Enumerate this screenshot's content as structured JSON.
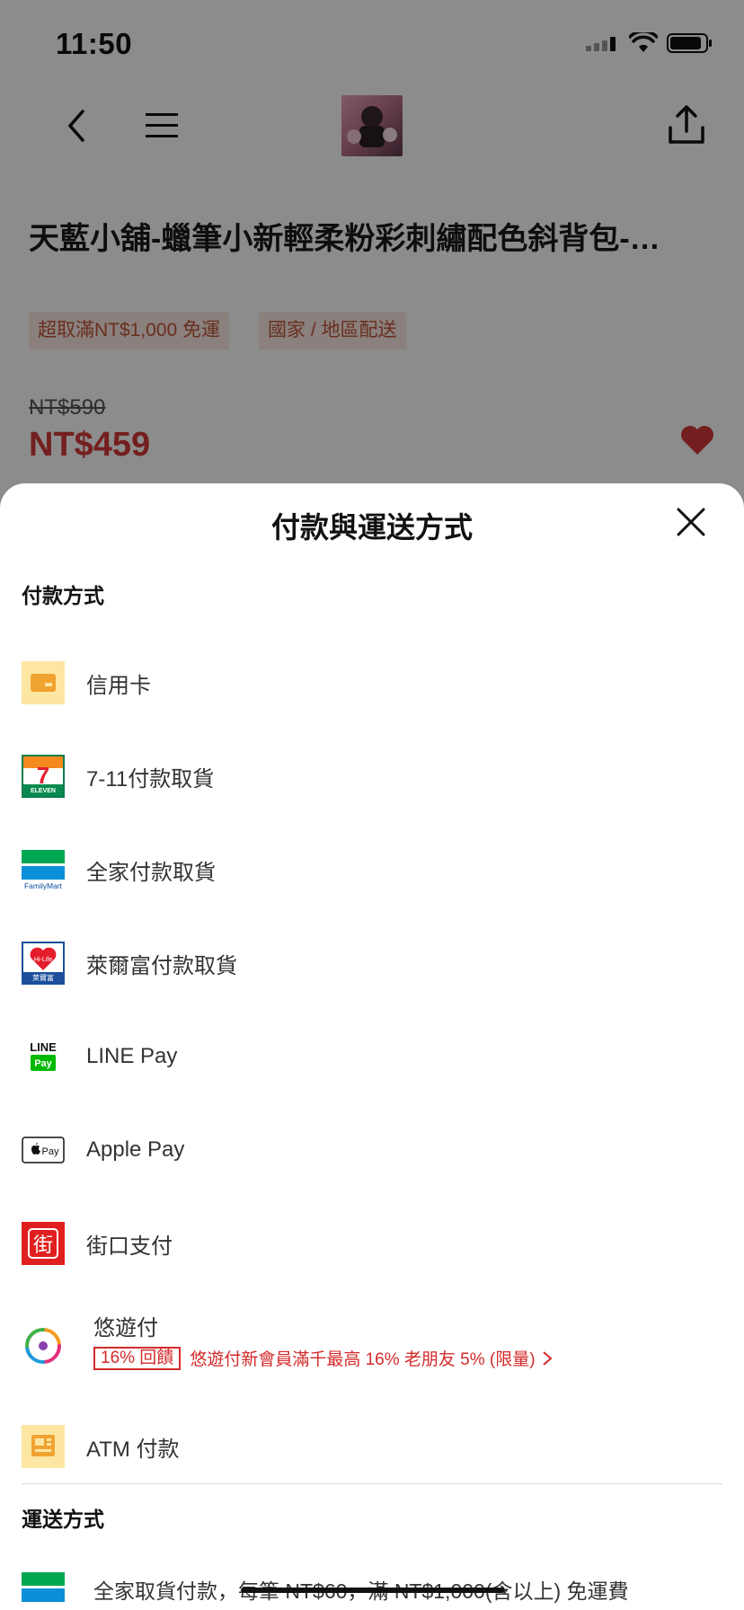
{
  "status": {
    "time": "11:50"
  },
  "product": {
    "title": "天藍小舖-蠟筆小新輕柔粉彩刺繡配色斜背包-…",
    "tags": [
      "超取滿NT$1,000 免運",
      "國家 / 地區配送"
    ],
    "original_price": "NT$590",
    "price": "NT$459"
  },
  "sheet": {
    "title": "付款與運送方式",
    "payment_section": "付款方式",
    "payment_methods": [
      {
        "label": "信用卡",
        "icon": "credit-card-icon"
      },
      {
        "label": "7-11付款取貨",
        "icon": "seven-eleven-icon"
      },
      {
        "label": "全家付款取貨",
        "icon": "familymart-icon"
      },
      {
        "label": "萊爾富付款取貨",
        "icon": "hilife-icon"
      },
      {
        "label": "LINE Pay",
        "icon": "line-pay-icon"
      },
      {
        "label": "Apple Pay",
        "icon": "apple-pay-icon"
      },
      {
        "label": "街口支付",
        "icon": "jkopay-icon"
      },
      {
        "label": "悠遊付",
        "icon": "easywallet-icon",
        "badge": "16% 回饋",
        "promo": "悠遊付新會員滿千最高 16% 老朋友 5% (限量)"
      },
      {
        "label": "ATM 付款",
        "icon": "atm-icon"
      }
    ],
    "shipping_section": "運送方式",
    "shipping_methods": [
      {
        "label": "全家取貨付款，每筆 NT$60，滿 NT$1,000(含以上) 免運費",
        "icon": "familymart-icon"
      }
    ]
  },
  "icons": {
    "logo_line": "LINE",
    "logo_pay": "Pay",
    "logo_familymart": "FamilyMart",
    "logo_eleven": "ELEVEN",
    "logo_hilife": "Hi-Life",
    "logo_hilife_cn": "萊爾富",
    "logo_jkopay": "街",
    "apple_pay": "Pay"
  },
  "colors": {
    "accent": "#d43a3a",
    "promo": "#d42a2a",
    "overlay": "rgba(0,0,0,0.45)"
  }
}
